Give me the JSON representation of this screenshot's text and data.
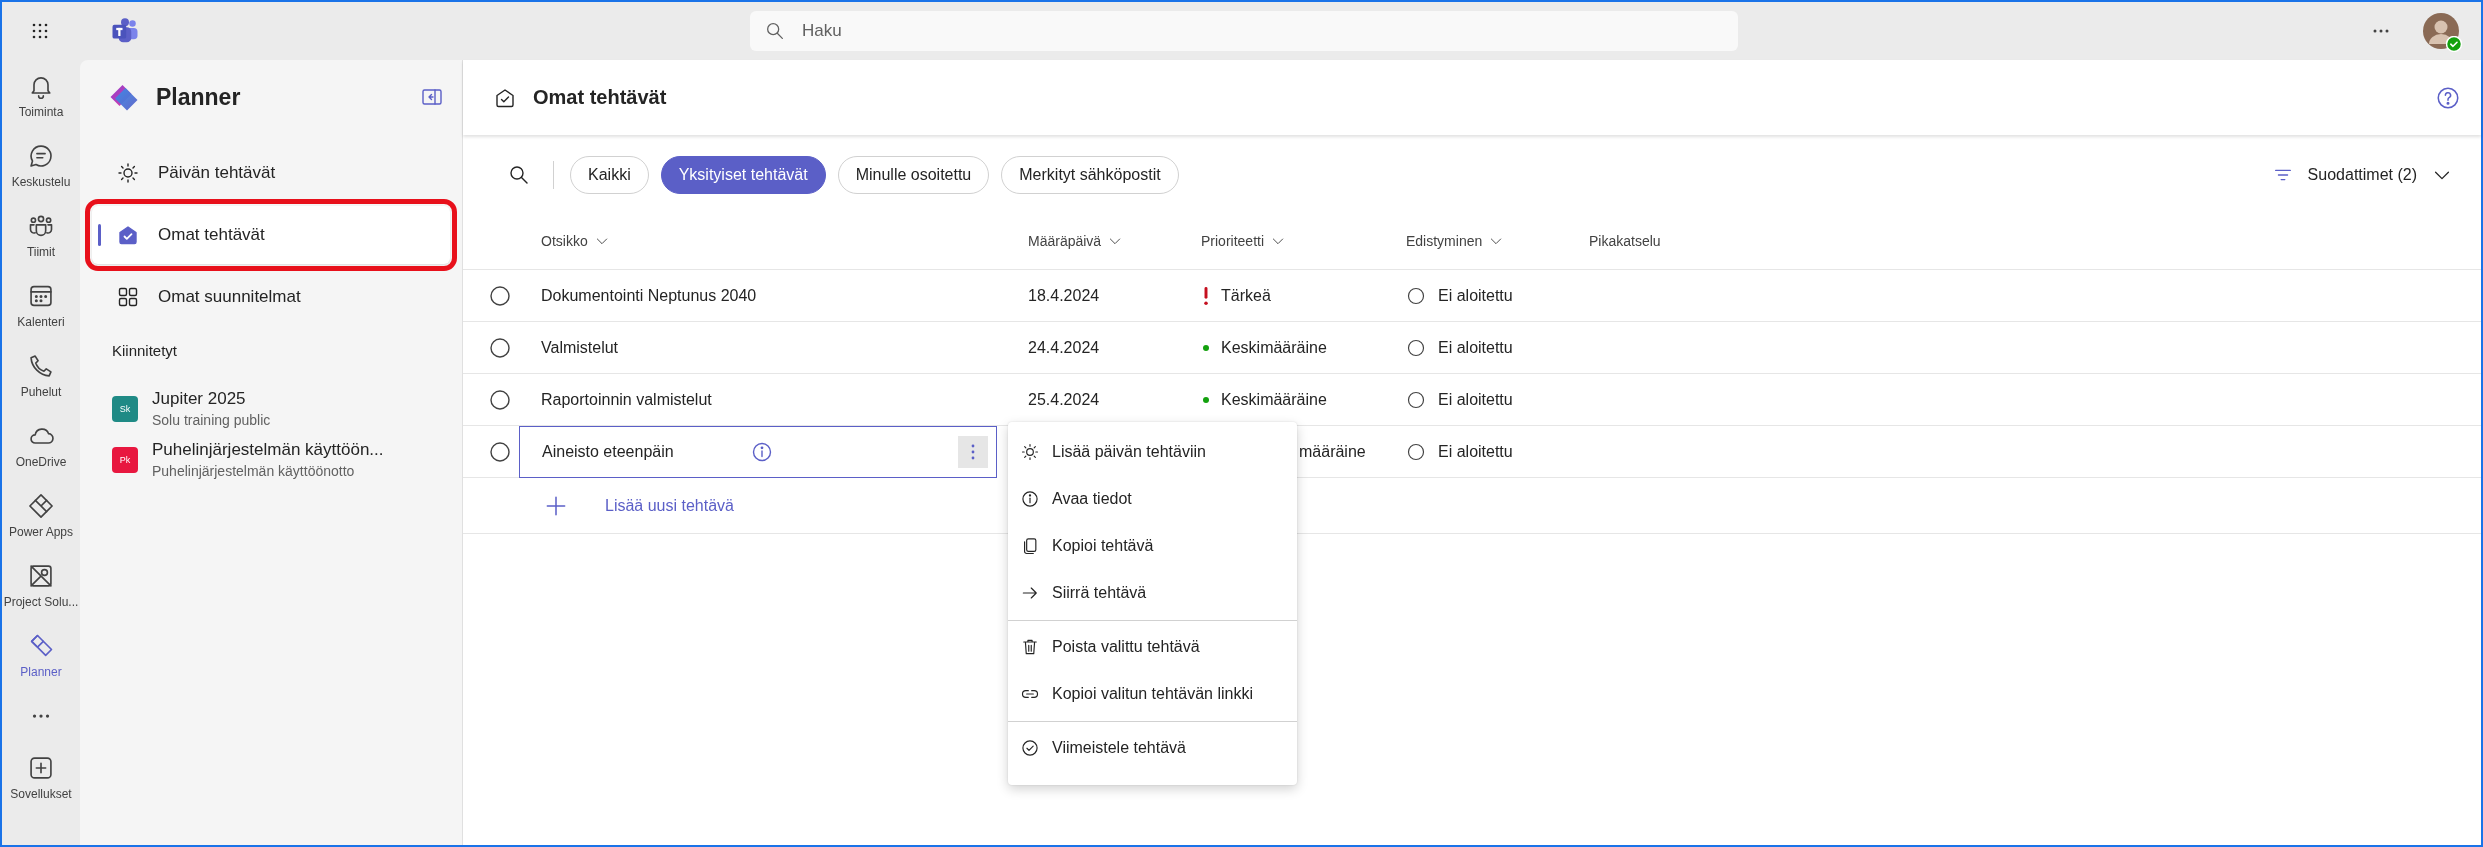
{
  "topbar": {
    "search_placeholder": "Haku"
  },
  "rail": {
    "items": [
      {
        "kind": "activity",
        "label": "Toiminta",
        "selected": false
      },
      {
        "kind": "chat",
        "label": "Keskustelu",
        "selected": false
      },
      {
        "kind": "teams",
        "label": "Tiimit",
        "selected": false
      },
      {
        "kind": "calendar",
        "label": "Kalenteri",
        "selected": false
      },
      {
        "kind": "calls",
        "label": "Puhelut",
        "selected": false
      },
      {
        "kind": "cloud",
        "label": "OneDrive",
        "selected": false
      },
      {
        "kind": "powerapps",
        "label": "Power Apps",
        "selected": false
      },
      {
        "kind": "project",
        "label": "Project Solu...",
        "selected": false
      },
      {
        "kind": "planner",
        "label": "Planner",
        "selected": true
      },
      {
        "kind": "more"
      },
      {
        "kind": "apps",
        "label": "Sovellukset",
        "selected": false
      }
    ]
  },
  "sidebar": {
    "title": "Planner",
    "nav": [
      {
        "kind": "day",
        "label": "Päivän tehtävät",
        "selected": false,
        "highlighted": false
      },
      {
        "kind": "mine",
        "label": "Omat tehtävät",
        "selected": true,
        "highlighted": true
      },
      {
        "kind": "plans",
        "label": "Omat suunnitelmat",
        "selected": false,
        "highlighted": false
      }
    ],
    "pinned_heading": "Kiinnitetyt",
    "pinned": [
      {
        "initials": "Sk",
        "name": "Jupiter 2025",
        "subtitle": "Solu training public",
        "color": "#1f8a85"
      },
      {
        "initials": "Pk",
        "name": "Puhelinjärjestelmän käyttöön...",
        "subtitle": "Puhelinjärjestelmän käyttöönotto",
        "color": "#e8173f"
      }
    ]
  },
  "main": {
    "title": "Omat tehtävät",
    "filters": [
      {
        "label": "Kaikki",
        "selected": false
      },
      {
        "label": "Yksityiset tehtävät",
        "selected": true
      },
      {
        "label": "Minulle osoitettu",
        "selected": false
      },
      {
        "label": "Merkityt sähköpostit",
        "selected": false
      }
    ],
    "filter_button": "Suodattimet (2)",
    "columns": [
      {
        "label": "Otsikko",
        "sortable": true
      },
      {
        "label": "Määräpäivä",
        "sortable": true
      },
      {
        "label": "Prioriteetti",
        "sortable": true
      },
      {
        "label": "Edistyminen",
        "sortable": true
      },
      {
        "label": "Pikakatselu",
        "sortable": false
      }
    ],
    "rows": [
      {
        "completed": false,
        "title": "Dokumentointi Neptunus 2040",
        "due": "18.4.2024",
        "priority": {
          "kind": "important",
          "label": "Tärkeä"
        },
        "progress": {
          "kind": "not_started",
          "label": "Ei aloitettu"
        },
        "focused": false
      },
      {
        "completed": false,
        "title": "Valmistelut",
        "due": "24.4.2024",
        "priority": {
          "kind": "medium",
          "label": "Keskimääräine"
        },
        "progress": {
          "kind": "not_started",
          "label": "Ei aloitettu"
        },
        "focused": false
      },
      {
        "completed": false,
        "title": "Raportoinnin valmistelut",
        "due": "25.4.2024",
        "priority": {
          "kind": "medium",
          "label": "Keskimääräine"
        },
        "progress": {
          "kind": "not_started",
          "label": "Ei aloitettu"
        },
        "focused": false
      },
      {
        "completed": false,
        "title": "Aineisto eteenpäin",
        "priority": {
          "kind": "covered",
          "label": "määräine"
        },
        "progress": {
          "kind": "not_started",
          "label": "Ei aloitettu"
        },
        "focused": true
      }
    ],
    "add_task": "Lisää uusi tehtävä",
    "context_menu": {
      "groups": [
        [
          {
            "kind": "sun",
            "label": "Lisää päivän tehtäviin"
          },
          {
            "kind": "info",
            "label": "Avaa tiedot"
          },
          {
            "kind": "copy",
            "label": "Kopioi tehtävä"
          },
          {
            "kind": "move",
            "label": "Siirrä tehtävä"
          }
        ],
        [
          {
            "kind": "delete",
            "label": "Poista valittu tehtävä"
          },
          {
            "kind": "link",
            "label": "Kopioi valitun tehtävän linkki"
          }
        ],
        [
          {
            "kind": "complete",
            "label": "Viimeistele tehtävä"
          }
        ]
      ]
    }
  }
}
